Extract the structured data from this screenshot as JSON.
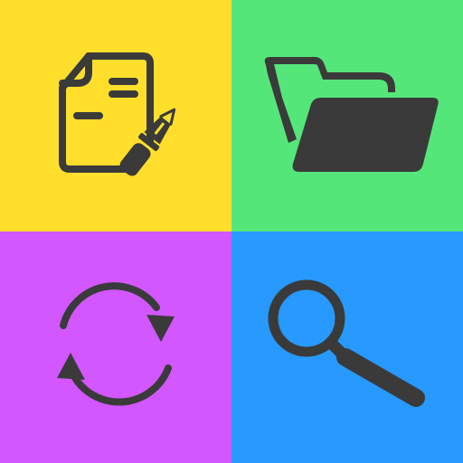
{
  "tiles": [
    {
      "id": "edit-document",
      "icon": "edit-document-icon",
      "background": "#FFDF2B"
    },
    {
      "id": "open-folder",
      "icon": "open-folder-icon",
      "background": "#55E67A"
    },
    {
      "id": "refresh",
      "icon": "refresh-icon",
      "background": "#D257FF"
    },
    {
      "id": "search",
      "icon": "search-icon",
      "background": "#2799FF"
    }
  ],
  "icon_color": "#3A3A3A"
}
